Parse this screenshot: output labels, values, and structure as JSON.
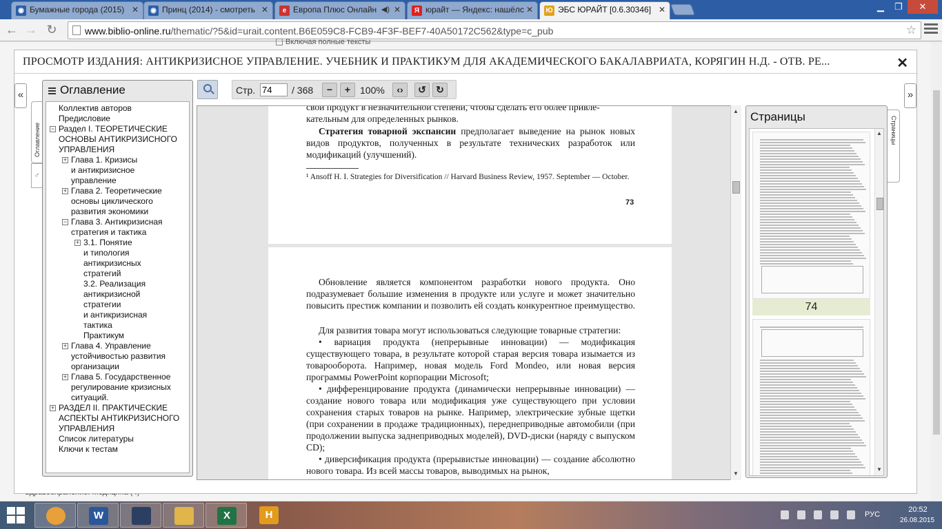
{
  "browser": {
    "tabs": [
      {
        "title": "Бумажные города (2015)",
        "favicon": "film-icon",
        "active": false
      },
      {
        "title": "Принц (2014) - смотреть",
        "favicon": "film-icon",
        "active": false
      },
      {
        "title": "Европа Плюс Онлайн",
        "favicon": "radio-icon",
        "active": false,
        "audio": true
      },
      {
        "title": "юрайт — Яндекс: нашёлс",
        "favicon": "yandex-icon",
        "active": false
      },
      {
        "title": "ЭБС ЮРАЙТ [0.6.30346]",
        "favicon": "urait-icon",
        "active": true
      }
    ],
    "url_host": "www.biblio-online.ru",
    "url_path": "/thematic/?5&id=urait.content.B6E059C8-FCB9-4F3F-BEF7-40A50172C562&type=c_pub",
    "star_icon": "star-icon"
  },
  "background_page": {
    "top_text": "Включая полные тексты",
    "bottom_text": "Здравоохранение. Медицина (4)"
  },
  "viewer": {
    "title": "ПРОСМОТР ИЗДАНИЯ: АНТИКРИЗИСНОЕ УПРАВЛЕНИЕ. УЧЕБНИК И ПРАКТИКУМ ДЛЯ АКАДЕМИЧЕСКОГО БАКАЛАВРИАТА, КОРЯГИН Н.Д. - ОТВ. РЕ...",
    "close_glyph": "✕",
    "left_collapse": "«",
    "right_collapse": "»",
    "toc_tab_label": "Оглавление",
    "pages_tab_label": "Страницы",
    "toolbar": {
      "page_label": "Стр.",
      "page_value": "74",
      "page_total": "/ 368",
      "zoom_out": "−",
      "zoom_in": "+",
      "zoom_level": "100%",
      "fit": "‹›",
      "rotate_left": "↺",
      "rotate_right": "↻"
    }
  },
  "toc": {
    "heading": "Оглавление",
    "items": [
      {
        "text": "Коллектив авторов",
        "level": 0,
        "toggle": ""
      },
      {
        "text": "Предисловие",
        "level": 0,
        "toggle": ""
      },
      {
        "text": "Раздел I. ТЕОРЕТИЧЕСКИЕ",
        "level": 0,
        "toggle": "−"
      },
      {
        "text": "ОСНОВЫ АНТИКРИЗИСНОГО",
        "level": 0,
        "toggle": ""
      },
      {
        "text": "УПРАВЛЕНИЯ",
        "level": 0,
        "toggle": ""
      },
      {
        "text": "Глава 1. Кризисы",
        "level": 1,
        "toggle": "+"
      },
      {
        "text": "и антикризисное",
        "level": 1,
        "toggle": ""
      },
      {
        "text": "управление",
        "level": 1,
        "toggle": ""
      },
      {
        "text": "Глава 2. Теоретические",
        "level": 1,
        "toggle": "+"
      },
      {
        "text": "основы циклического",
        "level": 1,
        "toggle": ""
      },
      {
        "text": "развития экономики",
        "level": 1,
        "toggle": ""
      },
      {
        "text": "Глава 3. Антикризисная",
        "level": 1,
        "toggle": "−"
      },
      {
        "text": "стратегия и тактика",
        "level": 1,
        "toggle": ""
      },
      {
        "text": "3.1. Понятие",
        "level": 2,
        "toggle": "+"
      },
      {
        "text": "и типология",
        "level": 2,
        "toggle": ""
      },
      {
        "text": "антикризисных",
        "level": 2,
        "toggle": ""
      },
      {
        "text": "стратегий",
        "level": 2,
        "toggle": ""
      },
      {
        "text": "3.2. Реализация",
        "level": 2,
        "toggle": ""
      },
      {
        "text": "антикризисной",
        "level": 2,
        "toggle": ""
      },
      {
        "text": "стратегии",
        "level": 2,
        "toggle": ""
      },
      {
        "text": "и антикризисная",
        "level": 2,
        "toggle": ""
      },
      {
        "text": "тактика",
        "level": 2,
        "toggle": ""
      },
      {
        "text": "Практикум",
        "level": 2,
        "toggle": ""
      },
      {
        "text": "Глава 4. Управление",
        "level": 1,
        "toggle": "+"
      },
      {
        "text": "устойчивостью развития",
        "level": 1,
        "toggle": ""
      },
      {
        "text": "организации",
        "level": 1,
        "toggle": ""
      },
      {
        "text": "Глава 5. Государственное",
        "level": 1,
        "toggle": "+"
      },
      {
        "text": "регулирование кризисных",
        "level": 1,
        "toggle": ""
      },
      {
        "text": "ситуаций.",
        "level": 1,
        "toggle": ""
      },
      {
        "text": "РАЗДЕЛ II. ПРАКТИЧЕСКИЕ",
        "level": 0,
        "toggle": "+"
      },
      {
        "text": "АСПЕКТЫ АНТИКРИЗИСНОГО",
        "level": 0,
        "toggle": ""
      },
      {
        "text": "УПРАВЛЕНИЯ",
        "level": 0,
        "toggle": ""
      },
      {
        "text": "Список литературы",
        "level": 0,
        "toggle": ""
      },
      {
        "text": "Ключи к тестам",
        "level": 0,
        "toggle": ""
      }
    ]
  },
  "document": {
    "page73": {
      "line_top": "свой продукт в незначительной степени, чтобы сделать его более привле-",
      "line_top2": "кательным для определенных рынков.",
      "strategy_bold": "Стратегия товарной экспансии",
      "strategy_rest": " предполагает выведение на рынок новых видов продуктов, полученных в результате технических разработок или модификаций (улучшений).",
      "footnote": "¹ Ansoff H. I. Strategies for Diversification // Harvard Business Review, 1957. September — October.",
      "page_number": "73"
    },
    "page74": {
      "p1": "Обновление является компонентом разработки нового продукта. Оно подразумевает большие изменения в продукте или услуге и может значительно повысить престиж компании и позволить ей создать конкурентное преимущество.",
      "p2": "Для развития товара могут использоваться следующие товарные стратегии:",
      "p3": "• вариация продукта (непрерывные инновации) — модификация существующего товара, в результате которой старая версия товара изымается из товарооборота. Например, новая модель Ford Mondeo, или новая версия программы PowerPoint корпорации Microsoft;",
      "p4": "• дифференцирование продукта (динамически непрерывные инновации) — создание нового товара или модификация уже существующего при условии сохранения старых товаров на рынке. Например, электрические зубные щетки (при сохранении в продаже традиционных), переднеприводные автомобили (при продолжении выпуска заднеприводных моделей), DVD-диски (наряду с выпуском CD);",
      "p5": "• диверсификация продукта (прерывистые инновации) — создание абсолютно нового товара. Из всей массы товаров, выводимых на рынок,"
    }
  },
  "pages_panel": {
    "heading": "Страницы",
    "current_label": "74"
  },
  "taskbar": {
    "apps": [
      {
        "name": "chrome",
        "label": "",
        "color": "#e8a03a"
      },
      {
        "name": "word",
        "label": "W",
        "color": "#2b579a"
      },
      {
        "name": "media",
        "label": "",
        "color": "#2b3f63"
      },
      {
        "name": "explorer",
        "label": "",
        "color": "#e0b54a"
      },
      {
        "name": "excel",
        "label": "X",
        "color": "#217346"
      },
      {
        "name": "h-app",
        "label": "H",
        "color": "#e39b1c"
      }
    ],
    "lang": "РУС",
    "time": "20:52",
    "date": "26.08.2015"
  }
}
